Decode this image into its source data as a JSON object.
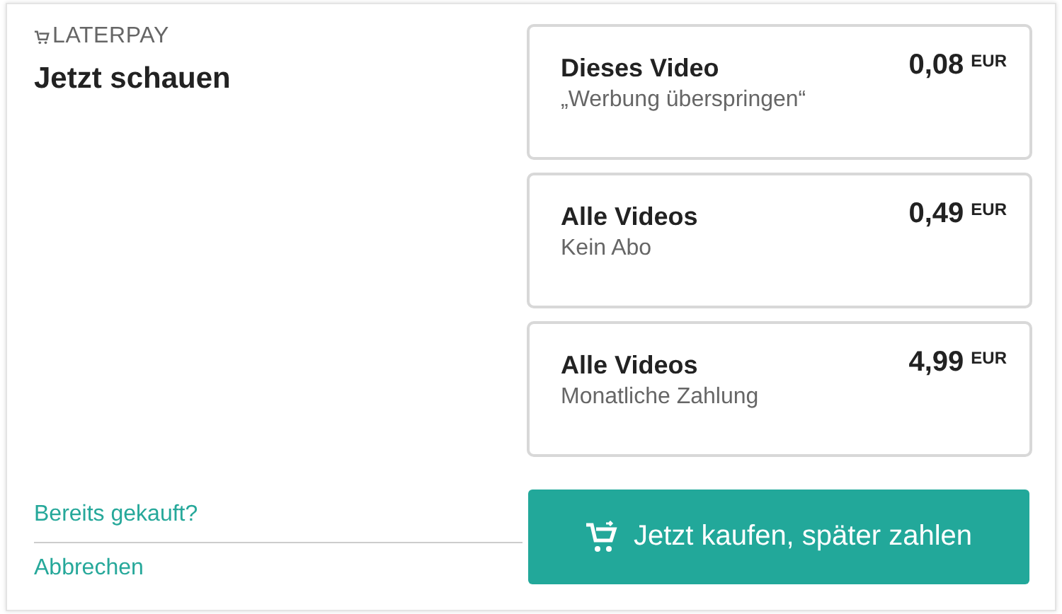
{
  "brand": "LATERPAY",
  "title": "Jetzt schauen",
  "offers": [
    {
      "name": "Dieses Video",
      "description": "„Werbung überspringen“",
      "price": "0,08",
      "currency": "EUR"
    },
    {
      "name": "Alle Videos",
      "description": "Kein Abo",
      "price": "0,49",
      "currency": "EUR"
    },
    {
      "name": "Alle Videos",
      "description": "Monatliche Zahlung",
      "price": "4,99",
      "currency": "EUR"
    }
  ],
  "links": [
    "Bereits gekauft?",
    "Abbrechen"
  ],
  "buy_button": "Jetzt kaufen, später zahlen"
}
